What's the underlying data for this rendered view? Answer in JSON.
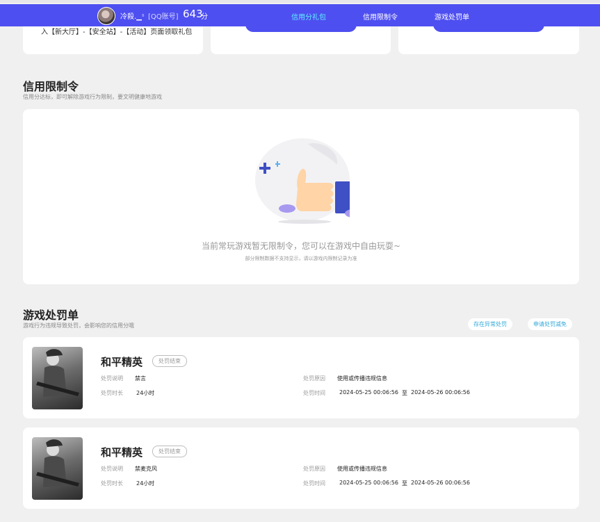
{
  "nav": {
    "nickname": "冷殺.▁ˢ",
    "account_type": "[QQ账号]",
    "score": "643",
    "score_unit": "分",
    "items": [
      "信用分礼包",
      "信用限制令",
      "游戏处罚单"
    ]
  },
  "top_cards": {
    "hint_text": "入【新大厅】-【安全站】-【活动】页面领取礼包"
  },
  "limit_section": {
    "title": "信用限制令",
    "subtitle": "信用分达标，即可解除游戏行为限制，要文明健康地游戏",
    "empty_main": "当前常玩游戏暂无限制令，您可以在游戏中自由玩耍~",
    "empty_sub": "部分限制数据不支持显示，请以游戏内限制记录为准"
  },
  "penalty_section": {
    "title": "游戏处罚单",
    "subtitle": "游戏行为违规导致处罚，会影响您的信用分哦",
    "btn_abnormal": "存在异常处罚",
    "btn_reduce": "申请处罚减免",
    "labels": {
      "desc": "处罚说明",
      "duration": "处罚时长",
      "reason": "处罚原因",
      "time": "处罚时间",
      "time_sep": "至"
    },
    "items": [
      {
        "game": "和平精英",
        "status": "处罚结束",
        "desc": "禁言",
        "duration": "24小时",
        "reason": "使用或传播违规信息",
        "start": "2024-05-25 00:06:56",
        "end": "2024-05-26 00:06:56"
      },
      {
        "game": "和平精英",
        "status": "处罚结束",
        "desc": "禁麦克风",
        "duration": "24小时",
        "reason": "使用或传播违规信息",
        "start": "2024-05-25 00:06:56",
        "end": "2024-05-26 00:06:56"
      }
    ]
  },
  "colors": {
    "nav_bg": "#4e4ff0",
    "nav_active": "#5ef2ff",
    "page_bg": "#f0f0f0",
    "pill_text": "#2fa7d8"
  }
}
